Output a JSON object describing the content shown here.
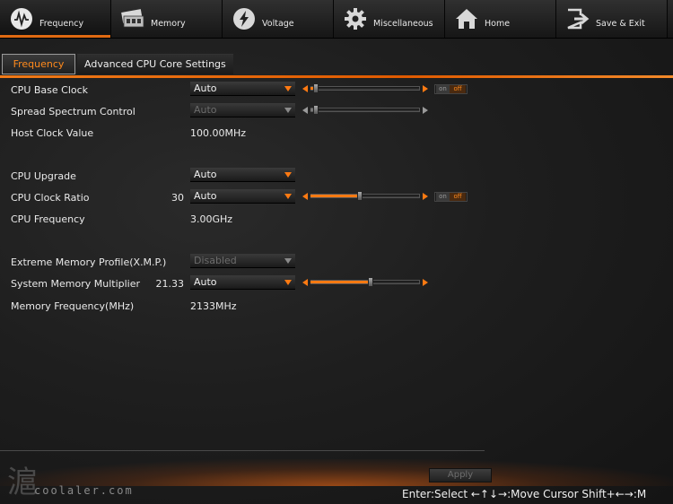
{
  "nav": {
    "tabs": [
      {
        "label": "Frequency",
        "icon": "frequency-icon",
        "active": true
      },
      {
        "label": "Memory",
        "icon": "memory-icon",
        "active": false
      },
      {
        "label": "Voltage",
        "icon": "voltage-icon",
        "active": false
      },
      {
        "label": "Miscellaneous",
        "icon": "gear-icon",
        "active": false
      },
      {
        "label": "Home",
        "icon": "home-icon",
        "active": false
      },
      {
        "label": "Save & Exit",
        "icon": "exit-icon",
        "active": false
      }
    ]
  },
  "subtabs": [
    {
      "label": "Frequency",
      "active": true
    },
    {
      "label": "Advanced CPU Core Settings",
      "active": false
    }
  ],
  "settings": {
    "cpu_base_clock": {
      "label": "CPU Base Clock",
      "value": "Auto",
      "slider_level": 0.05,
      "toggle_on": "on",
      "toggle_off": "off"
    },
    "spread_spectrum": {
      "label": "Spread Spectrum Control",
      "value": "Auto",
      "slider_level": 0.05
    },
    "host_clock": {
      "label": "Host Clock Value",
      "value": "100.00MHz"
    },
    "cpu_upgrade": {
      "label": "CPU Upgrade",
      "value": "Auto"
    },
    "cpu_clock_ratio": {
      "label": "CPU Clock Ratio",
      "number": "30",
      "value": "Auto",
      "slider_level": 0.45,
      "toggle_on": "on",
      "toggle_off": "off"
    },
    "cpu_frequency": {
      "label": "CPU Frequency",
      "value": "3.00GHz"
    },
    "xmp": {
      "label": "Extreme Memory Profile(X.M.P.)",
      "value": "Disabled"
    },
    "mem_multiplier": {
      "label": "System Memory Multiplier",
      "number": "21.33",
      "value": "Auto",
      "slider_level": 0.55
    },
    "mem_frequency": {
      "label": "Memory Frequency(MHz)",
      "value": "2133MHz"
    }
  },
  "footer": {
    "apply_label": "Apply",
    "help_text": "Enter:Select ←↑↓→:Move Cursor Shift+←→:M",
    "watermark_text": "coolaler.com",
    "watermark_glyph": "滬"
  },
  "colors": {
    "accent": "#ff7a12",
    "background": "#1c1c1c",
    "disabled_text": "#6c6c6c"
  }
}
